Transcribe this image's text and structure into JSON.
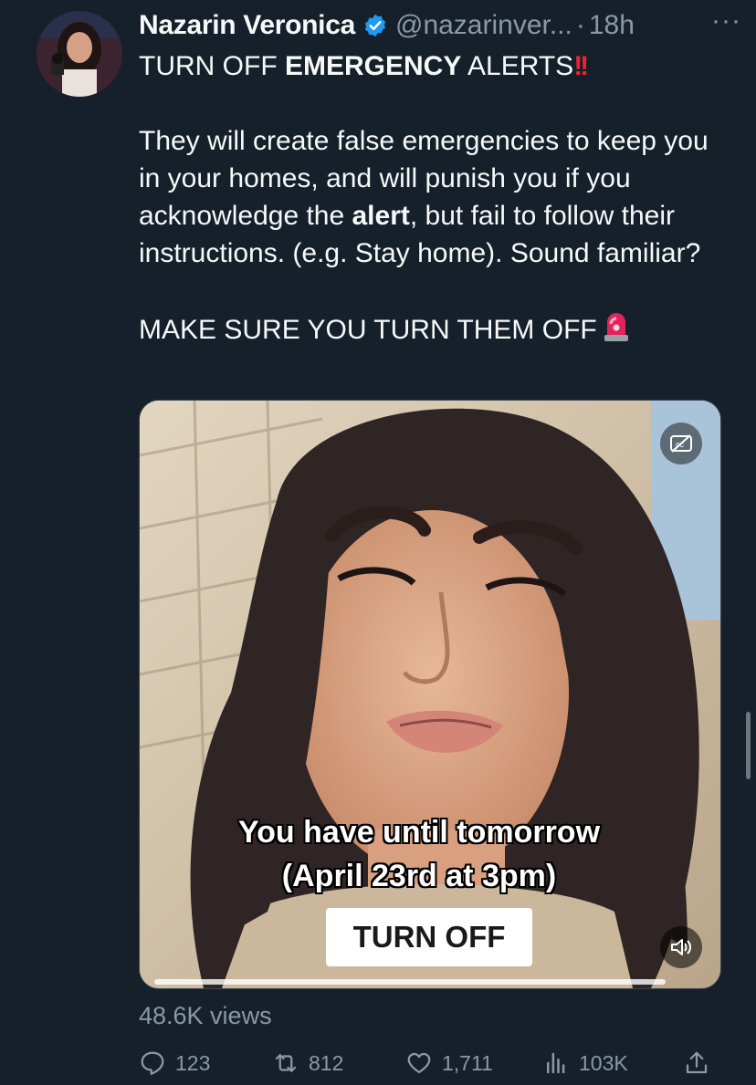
{
  "tweet": {
    "author_name": "Nazarin Veronica",
    "handle": "@nazarinver...",
    "separator": "·",
    "time": "18h",
    "more_label": "···",
    "line1_pre": "TURN OFF ",
    "line1_bold": "EMERGENCY",
    "line1_post": " ALERTS",
    "line1_emoji": "!!",
    "para2_a": "They will create false emergencies to keep you in your homes, and will punish you if you acknowledge the ",
    "para2_bold": "alert",
    "para2_b": ", but fail to follow their instructions. (e.g. Stay home). Sound familiar?",
    "para3": "MAKE SURE YOU TURN THEM OFF",
    "views": "48.6K views"
  },
  "media": {
    "caption_line1": "You have until tomorrow",
    "caption_line2": "(April 23rd at 3pm)",
    "button_text": "TURN OFF"
  },
  "actions": {
    "replies": "123",
    "retweets": "812",
    "likes": "1,711",
    "views": "103K"
  },
  "colors": {
    "background": "#15202b",
    "muted": "#8b98a5",
    "verified": "#1d9bf0",
    "alert_red": "#f4212e"
  }
}
